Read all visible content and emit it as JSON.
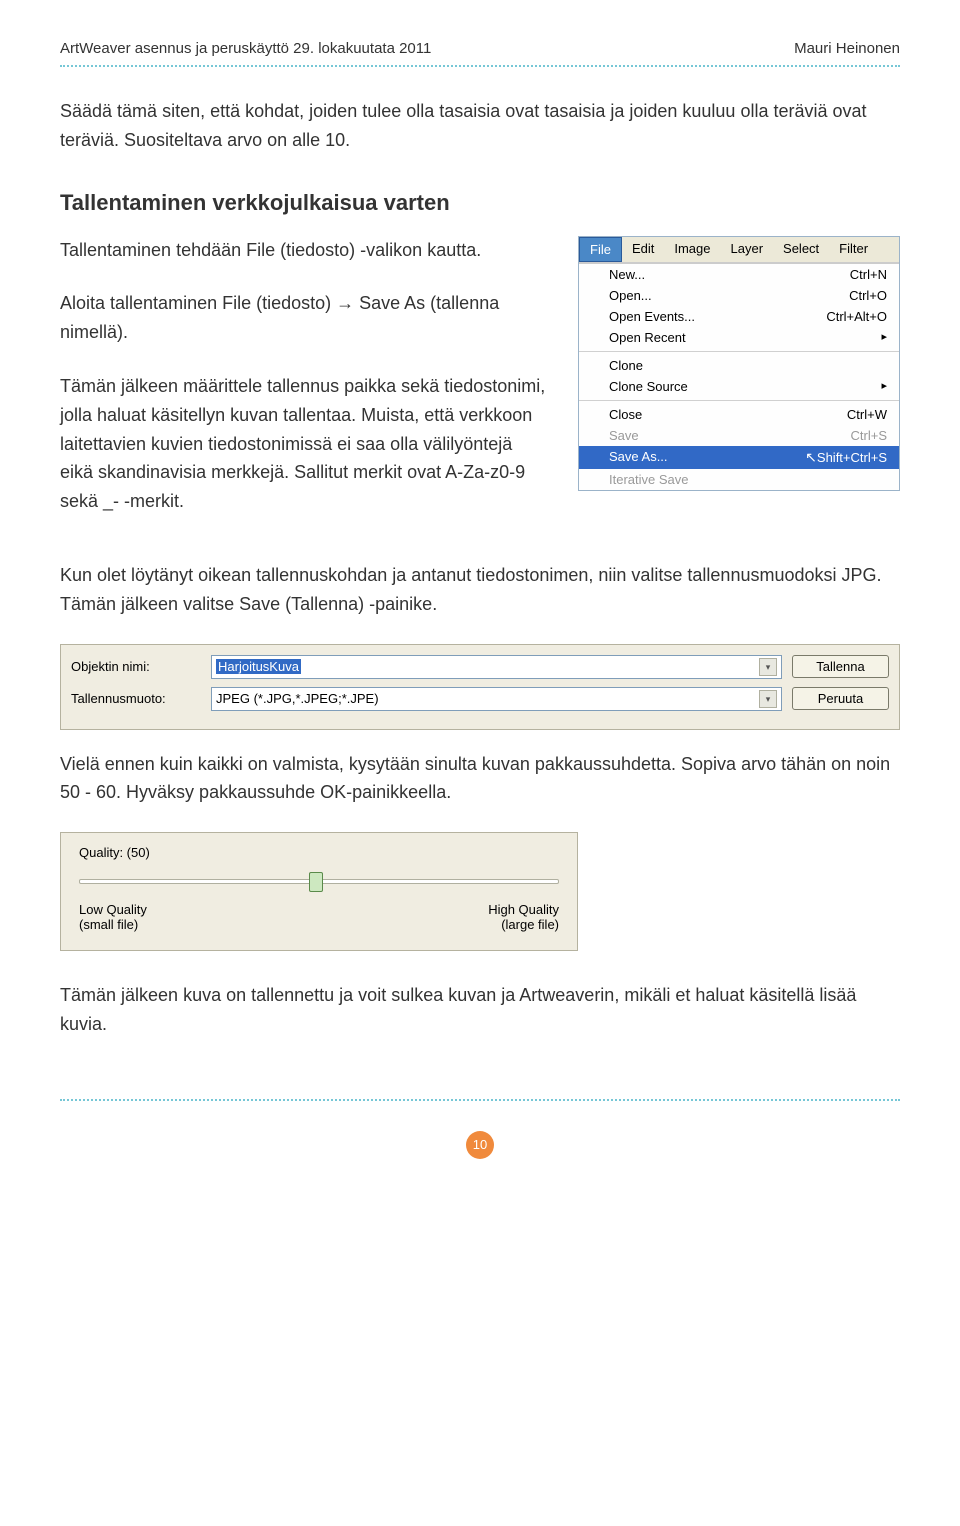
{
  "header": {
    "left": "ArtWeaver asennus ja peruskäyttö   29. lokakuutata 2011",
    "right": "Mauri Heinonen"
  },
  "intro_para": "Säädä tämä siten, että kohdat, joiden tulee olla tasaisia ovat tasaisia ja joiden kuuluu olla teräviä ovat teräviä. Suositeltava arvo on alle 10.",
  "section_heading": "Tallentaminen verkkojulkaisua varten",
  "para2": "Tallentaminen tehdään File (tiedosto) -valikon kautta.",
  "para3": "Aloita tallentaminen File (tiedosto) → Save As (tallenna nimellä).",
  "para4": "Tämän jälkeen määrittele tallennus paikka sekä tiedostonimi, jolla haluat käsitellyn kuvan tallentaa. Muista, että verkkoon laitettavien kuvien tiedostonimissä ei saa olla välilyöntejä eikä skandinavisia merkkejä. Sallitut merkit ovat A-Za-z0-9 sekä _- -merkit.",
  "para5": "Kun olet löytänyt oikean tallennuskohdan ja antanut tiedostonimen, niin valitse tallennusmuodoksi JPG. Tämän jälkeen valitse Save (Tallenna) -painike.",
  "para6": "Vielä ennen kuin kaikki on valmista, kysytään sinulta kuvan pakkaussuhdetta. Sopiva arvo tähän on noin 50 - 60. Hyväksy pakkaussuhde OK-painikkeella.",
  "para7": "Tämän jälkeen kuva on tallennettu ja voit sulkea kuvan ja Artweaverin, mikäli et haluat käsitellä lisää kuvia.",
  "menu": {
    "bar": [
      "File",
      "Edit",
      "Image",
      "Layer",
      "Select",
      "Filter"
    ],
    "items": [
      {
        "label": "New...",
        "shortcut": "Ctrl+N"
      },
      {
        "label": "Open...",
        "shortcut": "Ctrl+O"
      },
      {
        "label": "Open Events...",
        "shortcut": "Ctrl+Alt+O"
      },
      {
        "label": "Open Recent",
        "arrow": "▸"
      },
      {
        "label": "Clone",
        "sep": true
      },
      {
        "label": "Clone Source",
        "arrow": "▸"
      },
      {
        "label": "Close",
        "shortcut": "Ctrl+W",
        "sep": true
      },
      {
        "label": "Save",
        "shortcut": "Ctrl+S",
        "disabled": true
      },
      {
        "label": "Save As...",
        "shortcut": "Shift+Ctrl+S",
        "highlight": true
      },
      {
        "label": "Iterative Save",
        "disabled": true
      }
    ]
  },
  "save_dialog": {
    "label_name": "Objektin nimi:",
    "value_name": "HarjoitusKuva",
    "label_format": "Tallennusmuoto:",
    "value_format": "JPEG (*.JPG,*.JPEG;*.JPE)",
    "btn_save": "Tallenna",
    "btn_cancel": "Peruuta"
  },
  "quality_dialog": {
    "title": "Quality: (50)",
    "low1": "Low Quality",
    "low2": "(small file)",
    "high1": "High Quality",
    "high2": "(large file)"
  },
  "page_number": "10"
}
